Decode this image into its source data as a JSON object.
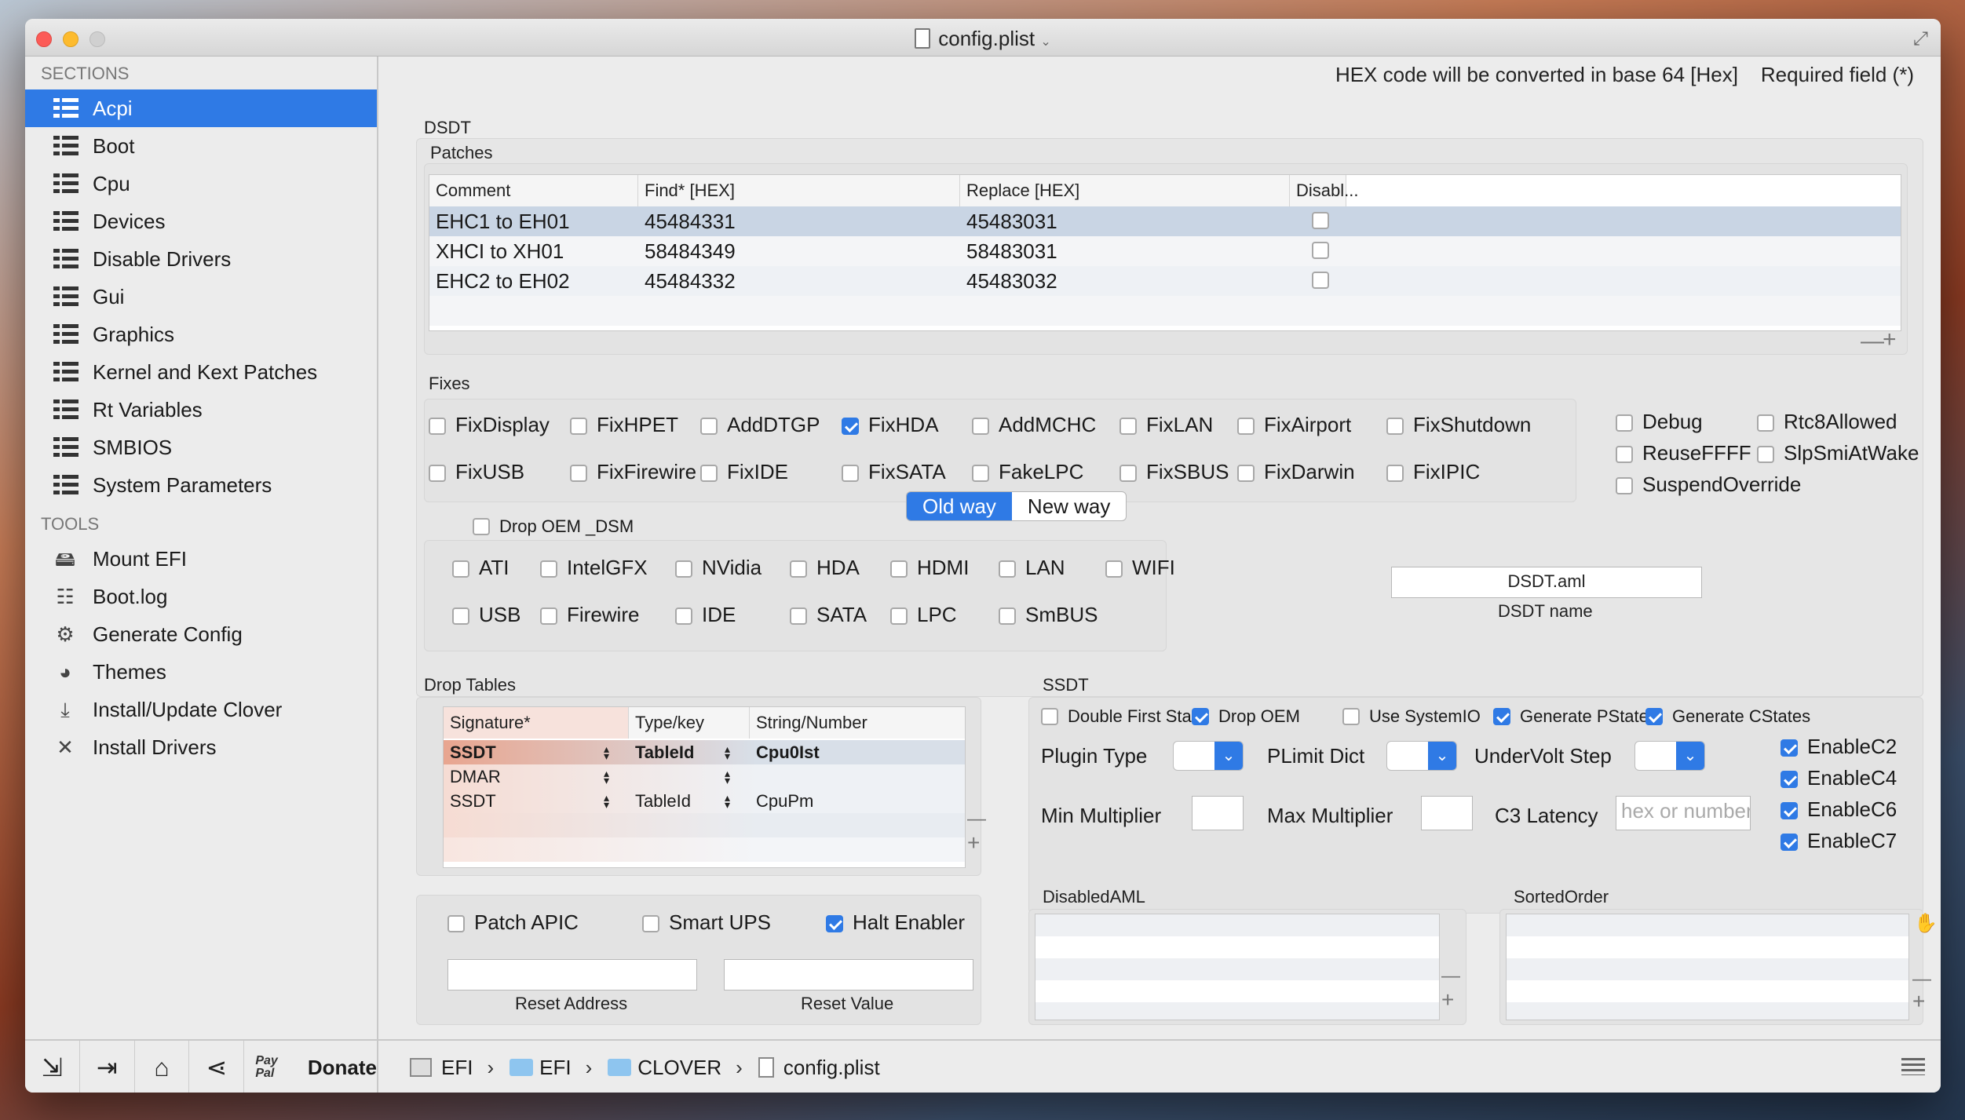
{
  "window": {
    "title": "config.plist"
  },
  "sidebar": {
    "sections_header": "SECTIONS",
    "sections": [
      "Acpi",
      "Boot",
      "Cpu",
      "Devices",
      "Disable Drivers",
      "Gui",
      "Graphics",
      "Kernel and Kext Patches",
      "Rt Variables",
      "SMBIOS",
      "System Parameters"
    ],
    "tools_header": "TOOLS",
    "tools": [
      {
        "label": "Mount EFI",
        "icon": "disk-icon"
      },
      {
        "label": "Boot.log",
        "icon": "log-icon"
      },
      {
        "label": "Generate Config",
        "icon": "gears-icon"
      },
      {
        "label": "Themes",
        "icon": "palette-icon"
      },
      {
        "label": "Install/Update Clover",
        "icon": "download-icon"
      },
      {
        "label": "Install Drivers",
        "icon": "tools-icon"
      }
    ]
  },
  "bottom": {
    "donate": "Donate",
    "paypal": "Pay Pal",
    "breadcrumb": [
      "EFI",
      "EFI",
      "CLOVER",
      "config.plist"
    ]
  },
  "header": {
    "hex_note": "HEX code will be converted in base 64 [Hex]",
    "required_note": "Required field (*)"
  },
  "dsdt": {
    "title": "DSDT",
    "patches_title": "Patches",
    "patch_columns": [
      "Comment",
      "Find* [HEX]",
      "Replace [HEX]",
      "Disabl..."
    ],
    "patches": [
      {
        "comment": "EHC1 to EH01",
        "find": "45484331",
        "replace": "45483031",
        "disabled": false
      },
      {
        "comment": "XHCI to XH01",
        "find": "58484349",
        "replace": "58483031",
        "disabled": false
      },
      {
        "comment": "EHC2 to EH02",
        "find": "45484332",
        "replace": "45483032",
        "disabled": false
      }
    ],
    "fixes_title": "Fixes",
    "fixes_row1": [
      {
        "l": "FixDisplay",
        "on": false
      },
      {
        "l": "FixHPET",
        "on": false
      },
      {
        "l": "AddDTGP",
        "on": false
      },
      {
        "l": "FixHDA",
        "on": true
      },
      {
        "l": "AddMCHC",
        "on": false
      },
      {
        "l": "FixLAN",
        "on": false
      },
      {
        "l": "FixAirport",
        "on": false
      },
      {
        "l": "FixShutdown",
        "on": false
      }
    ],
    "fixes_row2": [
      {
        "l": "FixUSB",
        "on": false
      },
      {
        "l": "FixFirewire",
        "on": false
      },
      {
        "l": "FixIDE",
        "on": false
      },
      {
        "l": "FixSATA",
        "on": false
      },
      {
        "l": "FakeLPC",
        "on": false
      },
      {
        "l": "FixSBUS",
        "on": false
      },
      {
        "l": "FixDarwin",
        "on": false
      },
      {
        "l": "FixIPIC",
        "on": false
      }
    ],
    "extra_fixes": [
      {
        "l": "Debug",
        "on": false
      },
      {
        "l": "Rtc8Allowed",
        "on": false
      },
      {
        "l": "ReuseFFFF",
        "on": false
      },
      {
        "l": "SlpSmiAtWake",
        "on": false
      },
      {
        "l": "SuspendOverride",
        "on": false
      }
    ],
    "seg_old": "Old way",
    "seg_new": "New way",
    "drop_oem_dsm": "Drop OEM _DSM",
    "dsm_row1": [
      "ATI",
      "IntelGFX",
      "NVidia",
      "HDA",
      "HDMI",
      "LAN",
      "WIFI"
    ],
    "dsm_row2": [
      "USB",
      "Firewire",
      "IDE",
      "SATA",
      "LPC",
      "SmBUS"
    ],
    "dsdt_name_value": "DSDT.aml",
    "dsdt_name_label": "DSDT name"
  },
  "drop_tables": {
    "title": "Drop Tables",
    "columns": [
      "Signature*",
      "Type/key",
      "String/Number"
    ],
    "rows": [
      {
        "sig": "SSDT",
        "type": "TableId",
        "str": "Cpu0Ist"
      },
      {
        "sig": "DMAR",
        "type": "",
        "str": ""
      },
      {
        "sig": "SSDT",
        "type": "TableId",
        "str": "CpuPm"
      }
    ]
  },
  "apic": {
    "patch_apic": "Patch APIC",
    "smart_ups": "Smart UPS",
    "halt_enabler": "Halt Enabler",
    "reset_address": "Reset Address",
    "reset_value": "Reset Value"
  },
  "ssdt": {
    "title": "SSDT",
    "checks": [
      {
        "l": "Double First State",
        "on": false
      },
      {
        "l": "Drop OEM",
        "on": true
      },
      {
        "l": "Use SystemIO",
        "on": false
      },
      {
        "l": "Generate PStates",
        "on": true
      },
      {
        "l": "Generate CStates",
        "on": true
      }
    ],
    "plugin_type": "Plugin Type",
    "plimit_dict": "PLimit Dict",
    "undervolt_step": "UnderVolt Step",
    "min_mult": "Min Multiplier",
    "max_mult": "Max Multiplier",
    "c3_latency": "C3 Latency",
    "c3_placeholder": "hex or number",
    "enable": [
      "EnableC2",
      "EnableC4",
      "EnableC6",
      "EnableC7"
    ]
  },
  "disabled_aml": "DisabledAML",
  "sorted_order": "SortedOrder",
  "colors": {
    "accent": "#2f7ae5"
  }
}
